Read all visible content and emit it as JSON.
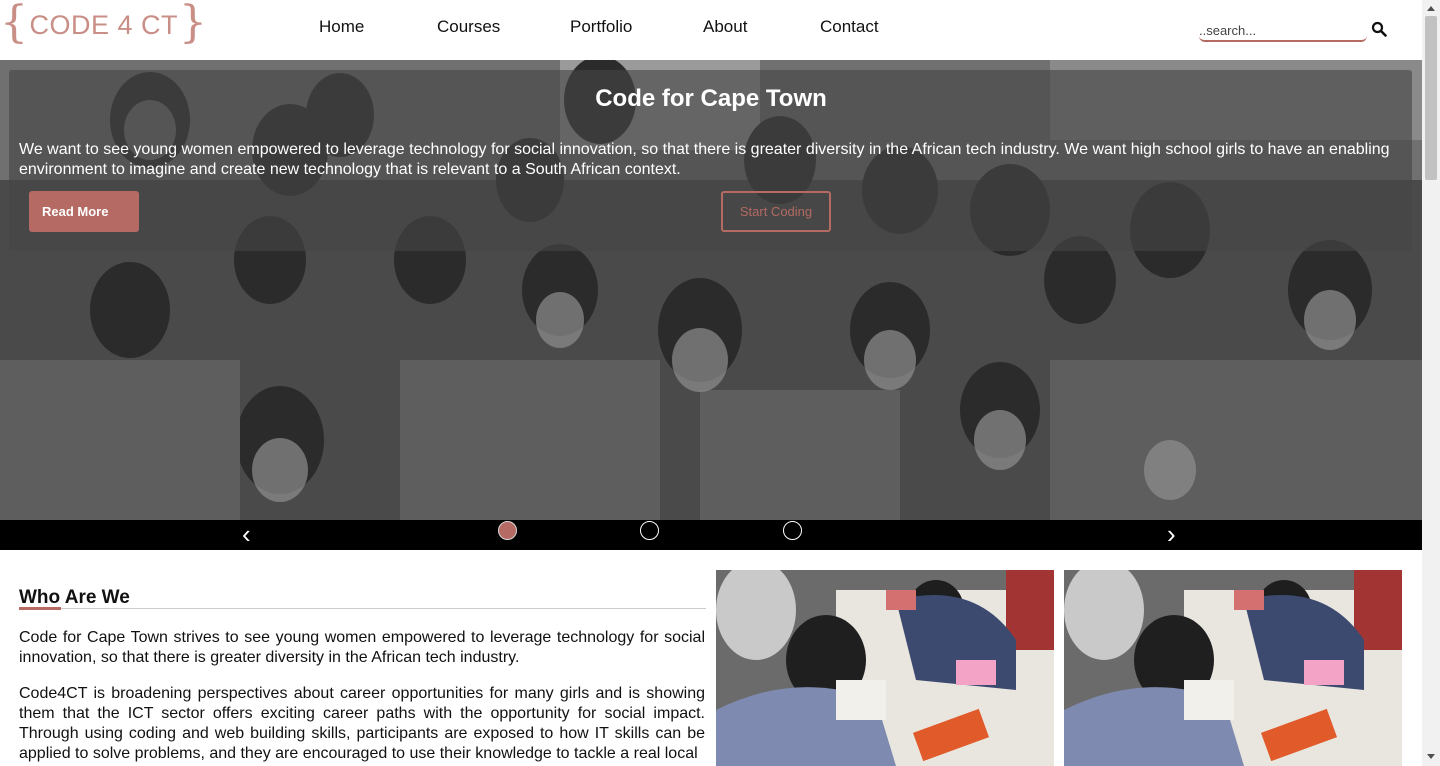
{
  "header": {
    "logo_text": "CODE 4 CT",
    "logo_left_brace": "{",
    "logo_right_brace": "}",
    "nav": [
      {
        "label": "Home"
      },
      {
        "label": "Courses"
      },
      {
        "label": "Portfolio"
      },
      {
        "label": "About"
      },
      {
        "label": "Contact"
      }
    ],
    "search": {
      "placeholder": "..search...",
      "icon": "search-icon"
    }
  },
  "hero": {
    "title": "Code for Cape Town",
    "text": "We want to see young women empowered to leverage technology for social innovation, so that there is greater diversity in the African tech industry. We want high school girls to have an enabling environment to imagine and create new technology that is relevant to a South African context.",
    "read_more_label": "Read More",
    "start_coding_label": "Start Coding",
    "prev_arrow": "‹",
    "next_arrow": "›",
    "slide_count": 3,
    "active_slide": 1
  },
  "who": {
    "heading": "Who Are We",
    "paragraph1": "Code for Cape Town strives to see young women empowered to leverage technology for social innovation, so that there is greater diversity in the African tech industry.",
    "paragraph2": "Code4CT is broadening perspectives about career opportunities for many girls and is showing them that the ICT sector offers exciting career paths with the opportunity for social impact. Through using coding and web building skills, participants are exposed to how IT skills can be applied to solve problems, and they are encouraged to use their knowledge to tackle a real local"
  },
  "colors": {
    "accent": "#b56a63",
    "logo": "#c98f86",
    "carousel_bar": "#000000"
  }
}
